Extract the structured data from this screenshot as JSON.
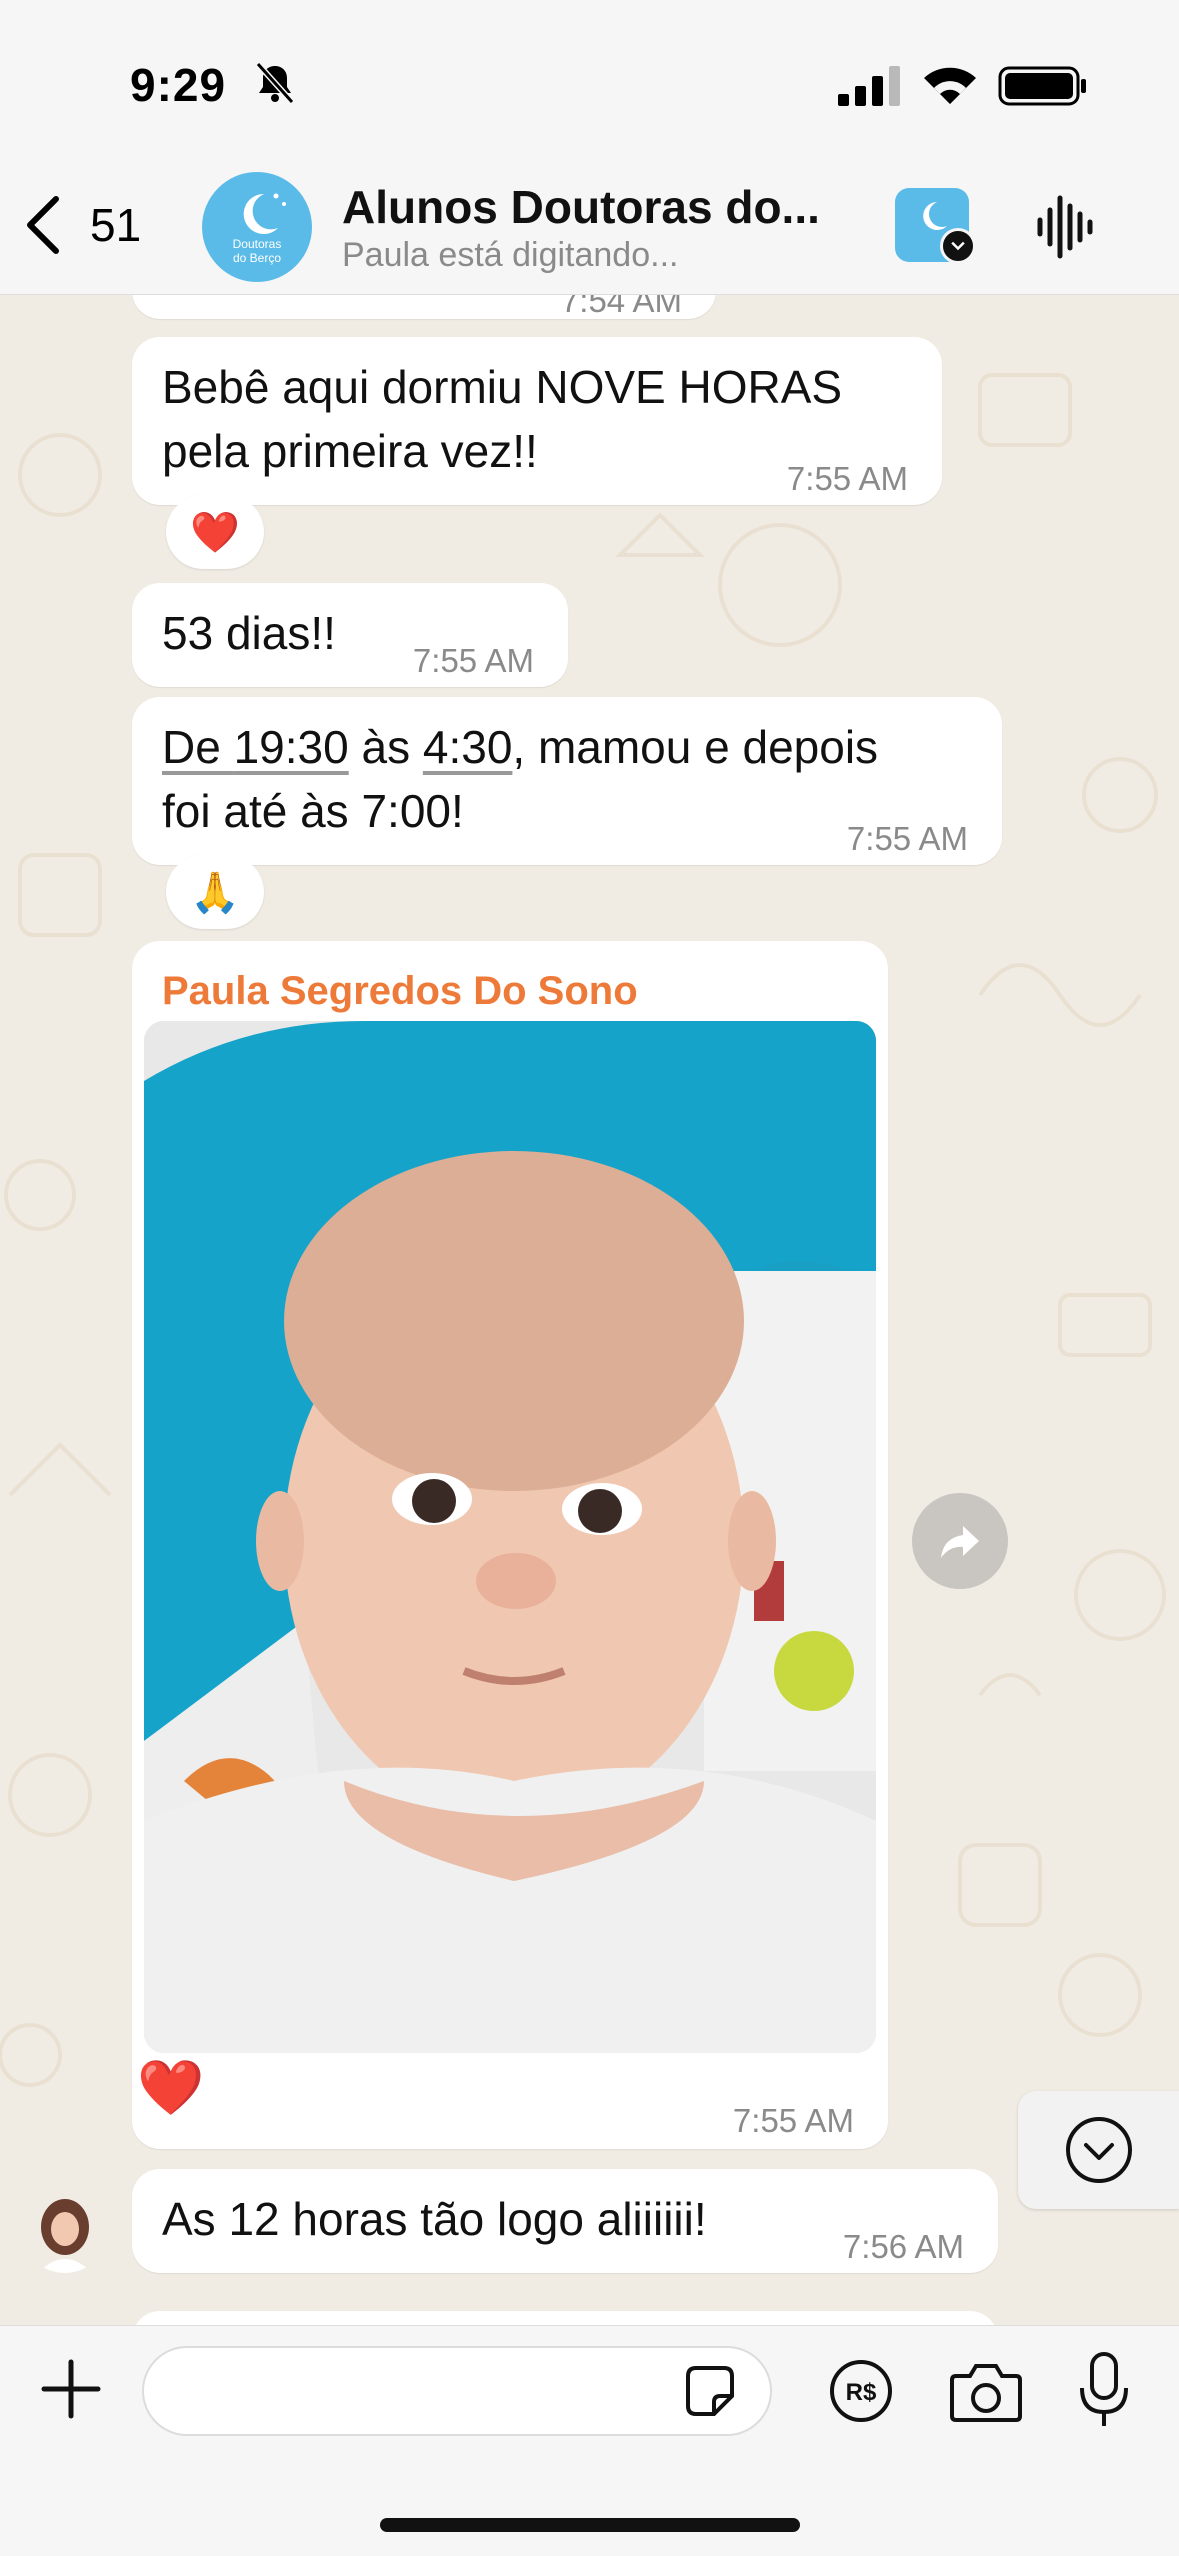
{
  "status_bar": {
    "time": "9:29"
  },
  "header": {
    "back_count": "51",
    "title": "Alunos Doutoras do...",
    "subtitle": "Paula está digitando...",
    "group_logo_text": "Doutoras do Berço"
  },
  "messages": [
    {
      "id": "m0",
      "text": "",
      "time": "7:54 AM"
    },
    {
      "id": "m1",
      "text_line1": "Bebê aqui dormiu NOVE HORAS",
      "text_line2": "pela primeira vez!!",
      "time": "7:55 AM",
      "reaction": "❤️"
    },
    {
      "id": "m2",
      "text": "53 dias!!",
      "time": "7:55 AM"
    },
    {
      "id": "m3",
      "seg_a": "De ",
      "seg_b": "19:30",
      "seg_c": " às ",
      "seg_d": "4:30",
      "seg_e": ", mamou e depois",
      "text_line2": "foi até às 7:00!",
      "time": "7:55 AM",
      "reaction": "🙏"
    },
    {
      "id": "m4",
      "sender": "Paula Segredos Do Sono",
      "media": "photo",
      "reaction": "❤️",
      "time": "7:55 AM"
    },
    {
      "id": "m5",
      "text": "As 12 horas tão logo aliiiiii!",
      "time": "7:56 AM"
    }
  ],
  "icons": {
    "back": "chevron-left-icon",
    "voice": "audio-waveform-icon",
    "forward": "share-arrow-icon",
    "scroll_down": "chevron-down-circle-icon",
    "plus": "plus-icon",
    "sticker": "sticker-icon",
    "payment": "brl-payment-icon",
    "camera": "camera-icon",
    "mic": "microphone-icon"
  },
  "colors": {
    "sender_name": "#ee7a3a",
    "chat_bg": "#f1ece3",
    "bubble_bg": "#ffffff",
    "avatar_blue": "#5bbbe8"
  }
}
